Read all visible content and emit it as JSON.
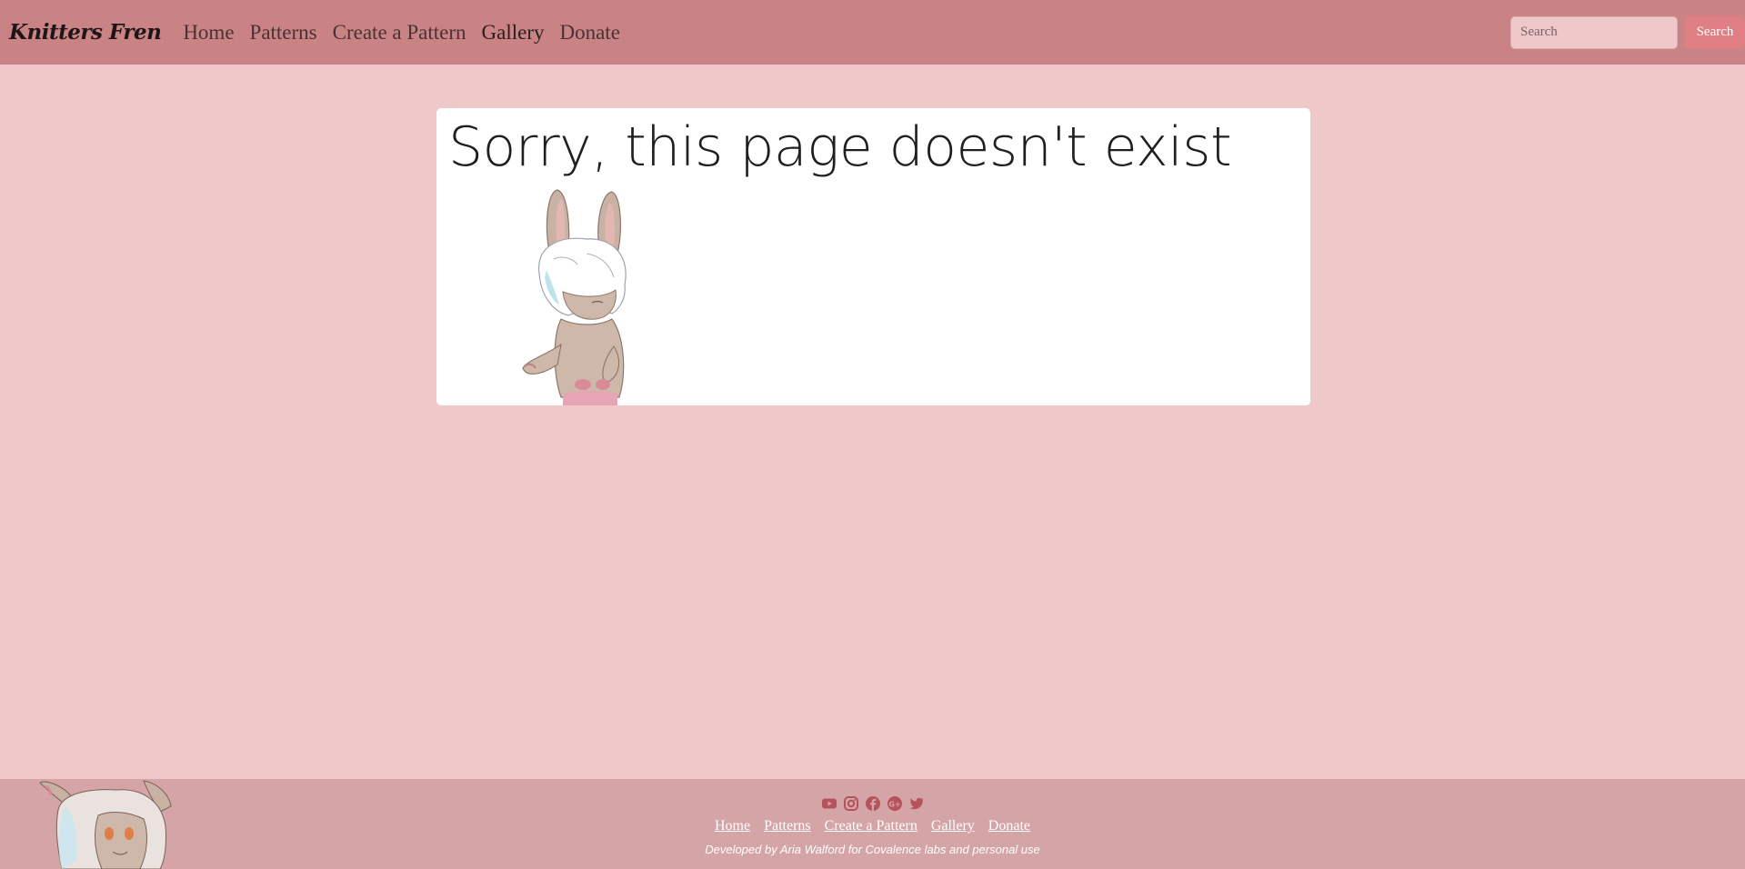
{
  "navbar": {
    "brand": "Knitters Fren",
    "links": [
      {
        "label": "Home"
      },
      {
        "label": "Patterns"
      },
      {
        "label": "Create a Pattern"
      },
      {
        "label": "Gallery"
      },
      {
        "label": "Donate"
      }
    ],
    "search": {
      "placeholder": "Search",
      "value": "",
      "button_label": "Search"
    }
  },
  "main": {
    "title": "Sorry, this page doesn't exist",
    "illustration": "bunny-character-illustration"
  },
  "footer": {
    "social_icons": [
      "youtube-icon",
      "instagram-icon",
      "facebook-icon",
      "google-plus-icon",
      "twitter-icon"
    ],
    "links": [
      {
        "label": "Home"
      },
      {
        "label": "Patterns"
      },
      {
        "label": "Create a Pattern"
      },
      {
        "label": "Gallery"
      },
      {
        "label": "Donate"
      }
    ],
    "credit": "Developed by Aria Walford for Covalence labs and personal use",
    "mascot": "bunny-character-illustration"
  },
  "colors": {
    "navbar": "#ca8384",
    "page_background": "#efc9ca",
    "footer": "#d4a4a6",
    "search_button": "#e07f83",
    "social_icon": "#b5535a"
  }
}
